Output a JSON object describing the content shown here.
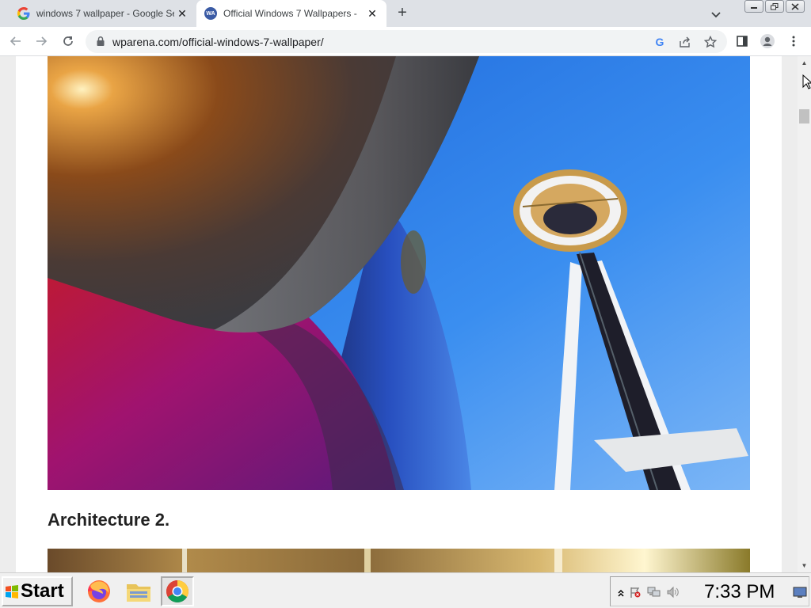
{
  "browser": {
    "tabs": [
      {
        "title": "windows 7 wallpaper - Google Se",
        "favicon": "google-icon",
        "active": false
      },
      {
        "title": "Official Windows 7 Wallpapers -",
        "favicon": "wparena-icon",
        "active": true
      }
    ],
    "new_tab_label": "+",
    "url": "wparena.com/official-windows-7-wallpaper/"
  },
  "page": {
    "image_caption": "Architecture 2."
  },
  "taskbar": {
    "start_label": "Start",
    "clock": "7:33 PM",
    "apps": [
      "firefox-icon",
      "file-manager-icon",
      "chrome-icon"
    ]
  },
  "colors": {
    "sky": "#2a7ee6",
    "tabstrip": "#dee1e6"
  }
}
